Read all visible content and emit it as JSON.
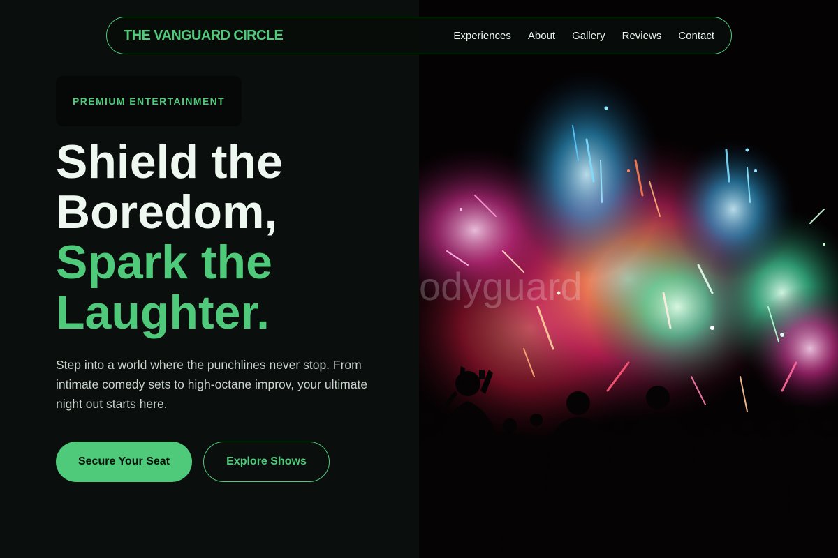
{
  "nav": {
    "brand": "THE VANGUARD CIRCLE",
    "links": [
      "Experiences",
      "About",
      "Gallery",
      "Reviews",
      "Contact"
    ]
  },
  "hero": {
    "badge": "PREMIUM ENTERTAINMENT",
    "headline_line1": "Shield the",
    "headline_line2": "Boredom,",
    "headline_line3": "Spark the",
    "headline_line4": "Laughter.",
    "description": "Step into a world where the punchlines never stop. From intimate comedy sets to high-octane improv, your ultimate night out starts here.",
    "primary_cta": "Secure Your Seat",
    "secondary_cta": "Explore Shows",
    "image_subject": "fireworks-crowd-silhouette"
  },
  "colors": {
    "accent": "#4fc97a",
    "background": "#0a0d0c",
    "headline_white": "#eef8f1",
    "body_text": "#c9d4ce"
  }
}
